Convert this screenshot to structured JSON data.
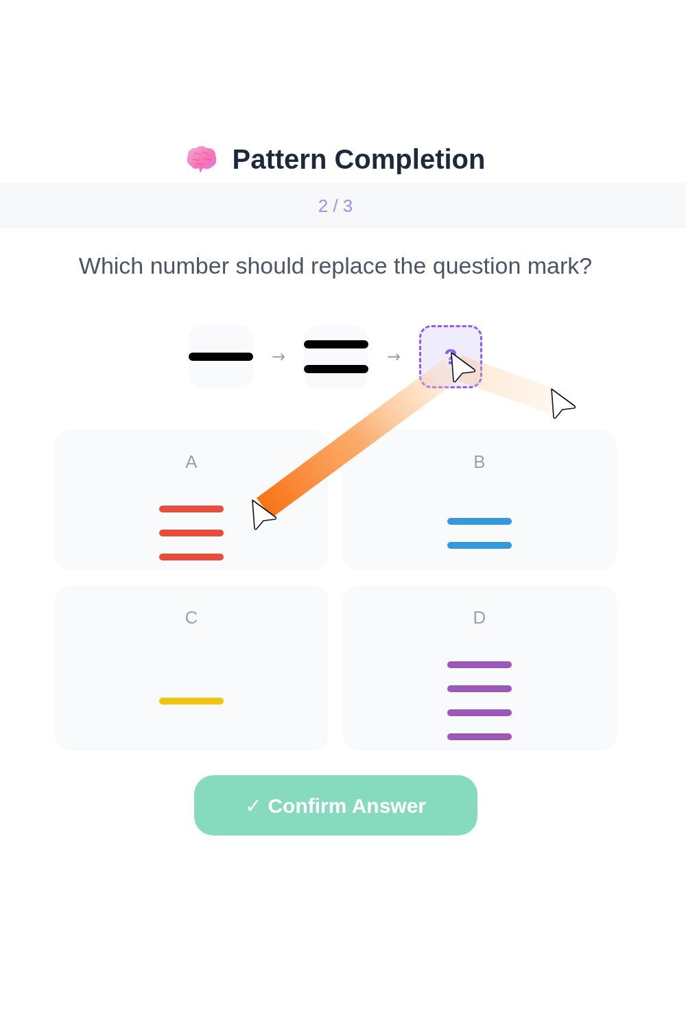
{
  "header": {
    "title": "Pattern Completion"
  },
  "progress": {
    "text": "2 / 3"
  },
  "question": "Which number should replace the question mark?",
  "sequence": [
    {
      "kind": "pattern",
      "bars": [
        {
          "kind": "line"
        }
      ]
    },
    {
      "kind": "arrow",
      "text": "→"
    },
    {
      "kind": "pattern",
      "bars": [
        {
          "kind": "line"
        },
        {
          "kind": "line"
        }
      ]
    },
    {
      "kind": "arrow",
      "text": "→"
    },
    {
      "kind": "blank",
      "text": "?"
    }
  ],
  "options": [
    {
      "label": "A",
      "selected": false,
      "color": "#e74c3c",
      "bars": [
        {
          "kind": "line"
        },
        {
          "kind": "line"
        },
        {
          "kind": "line"
        }
      ]
    },
    {
      "label": "B",
      "selected": false,
      "color": "#3498db",
      "bars": [
        {
          "kind": "line"
        },
        {
          "kind": "line"
        }
      ]
    },
    {
      "label": "C",
      "selected": false,
      "color": "#f1c40f",
      "bars": [
        {
          "kind": "line"
        }
      ]
    },
    {
      "label": "D",
      "selected": false,
      "color": "#9b59b6",
      "bars": [
        {
          "kind": "line"
        },
        {
          "kind": "line"
        },
        {
          "kind": "line"
        },
        {
          "kind": "line"
        }
      ]
    }
  ],
  "confirm_button": {
    "label": "✓ Confirm Answer",
    "disabled": true
  }
}
